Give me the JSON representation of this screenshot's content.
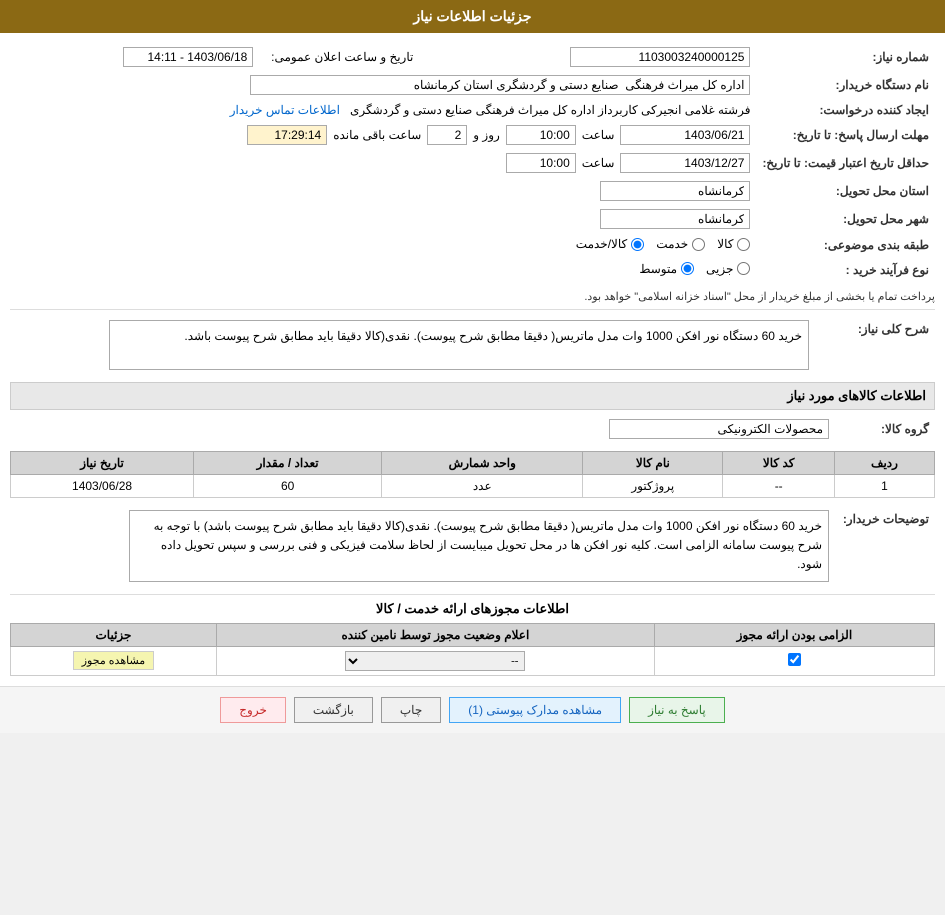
{
  "header": {
    "title": "جزئیات اطلاعات نیاز"
  },
  "fields": {
    "need_number_label": "شماره نیاز:",
    "need_number_value": "1103003240000125",
    "announce_date_label": "تاریخ و ساعت اعلان عمومی:",
    "announce_date_value": "1403/06/18 - 14:11",
    "buyer_name_label": "نام دستگاه خریدار:",
    "buyer_name_value": "اداره کل میراث فرهنگی  صنایع دستی و گردشگری استان کرمانشاه",
    "creator_label": "ایجاد کننده درخواست:",
    "creator_value": "فرشته غلامی انجیرکی کاربرداز اداره کل میراث فرهنگی  صنایع دستی و گردشگری",
    "contact_link": "اطلاعات تماس خریدار",
    "deadline_label": "مهلت ارسال پاسخ: تا تاریخ:",
    "deadline_date_value": "1403/06/21",
    "deadline_time_label": "ساعت",
    "deadline_time_value": "10:00",
    "deadline_days_label": "روز و",
    "deadline_days_value": "2",
    "deadline_remaining_label": "ساعت باقی مانده",
    "deadline_remaining_value": "17:29:14",
    "credit_label": "حداقل تاریخ اعتبار قیمت: تا تاریخ:",
    "credit_date_value": "1403/12/27",
    "credit_time_label": "ساعت",
    "credit_time_value": "10:00",
    "province_label": "استان محل تحویل:",
    "province_value": "کرمانشاه",
    "city_label": "شهر محل تحویل:",
    "city_value": "کرمانشاه",
    "type_label": "طبقه بندی موضوعی:",
    "type_options": [
      "کالا",
      "خدمت",
      "کالا/خدمت"
    ],
    "type_selected": "کالا/خدمت",
    "purchase_type_label": "نوع فرآیند خرید :",
    "purchase_options": [
      "جزیی",
      "متوسط"
    ],
    "purchase_selected": "متوسط",
    "payment_note": "پرداخت تمام یا بخشی از مبلغ خریدار از محل \"اسناد خزانه اسلامی\" خواهد بود."
  },
  "need_description": {
    "title": "شرح کلی نیاز:",
    "text": "خرید 60 دستگاه نور افکن 1000 وات مدل ماتریس( دقیقا مطابق شرح پیوست). نقدی(کالا دقیقا باید مطابق شرح پیوست باشد."
  },
  "goods_info": {
    "title": "اطلاعات کالاهای مورد نیاز",
    "group_label": "گروه کالا:",
    "group_value": "محصولات الکترونیکی",
    "columns": [
      "ردیف",
      "کد کالا",
      "نام کالا",
      "واحد شمارش",
      "تعداد / مقدار",
      "تاریخ نیاز"
    ],
    "rows": [
      {
        "row_num": "1",
        "code": "--",
        "name": "پروژکتور",
        "unit": "عدد",
        "qty": "60",
        "date": "1403/06/28"
      }
    ]
  },
  "buyer_notes": {
    "title": "توضیحات خریدار:",
    "text": "خرید 60 دستگاه نور افکن 1000 وات مدل ماتریس( دقیقا مطابق شرح پیوست). نقدی(کالا دقیقا باید مطابق شرح پیوست باشد) با توجه به شرح پیوست سامانه الزامی است. کلیه نور افکن ها در محل تحویل میبایست از لحاظ سلامت فیزیکی و فنی بررسی و سپس تحویل داده شود."
  },
  "license_section": {
    "title": "اطلاعات مجوزهای ارائه خدمت / کالا",
    "columns": [
      "الزامی بودن ارائه مجوز",
      "اعلام وضعیت مجوز توسط نامین کننده",
      "جزئیات"
    ],
    "rows": [
      {
        "required": true,
        "status": "--",
        "action": "مشاهده مجوز"
      }
    ]
  },
  "buttons": {
    "reply": "پاسخ به نیاز",
    "view_docs": "مشاهده مدارک پیوستی (1)",
    "print": "چاپ",
    "back": "بازگشت",
    "exit": "خروج"
  }
}
